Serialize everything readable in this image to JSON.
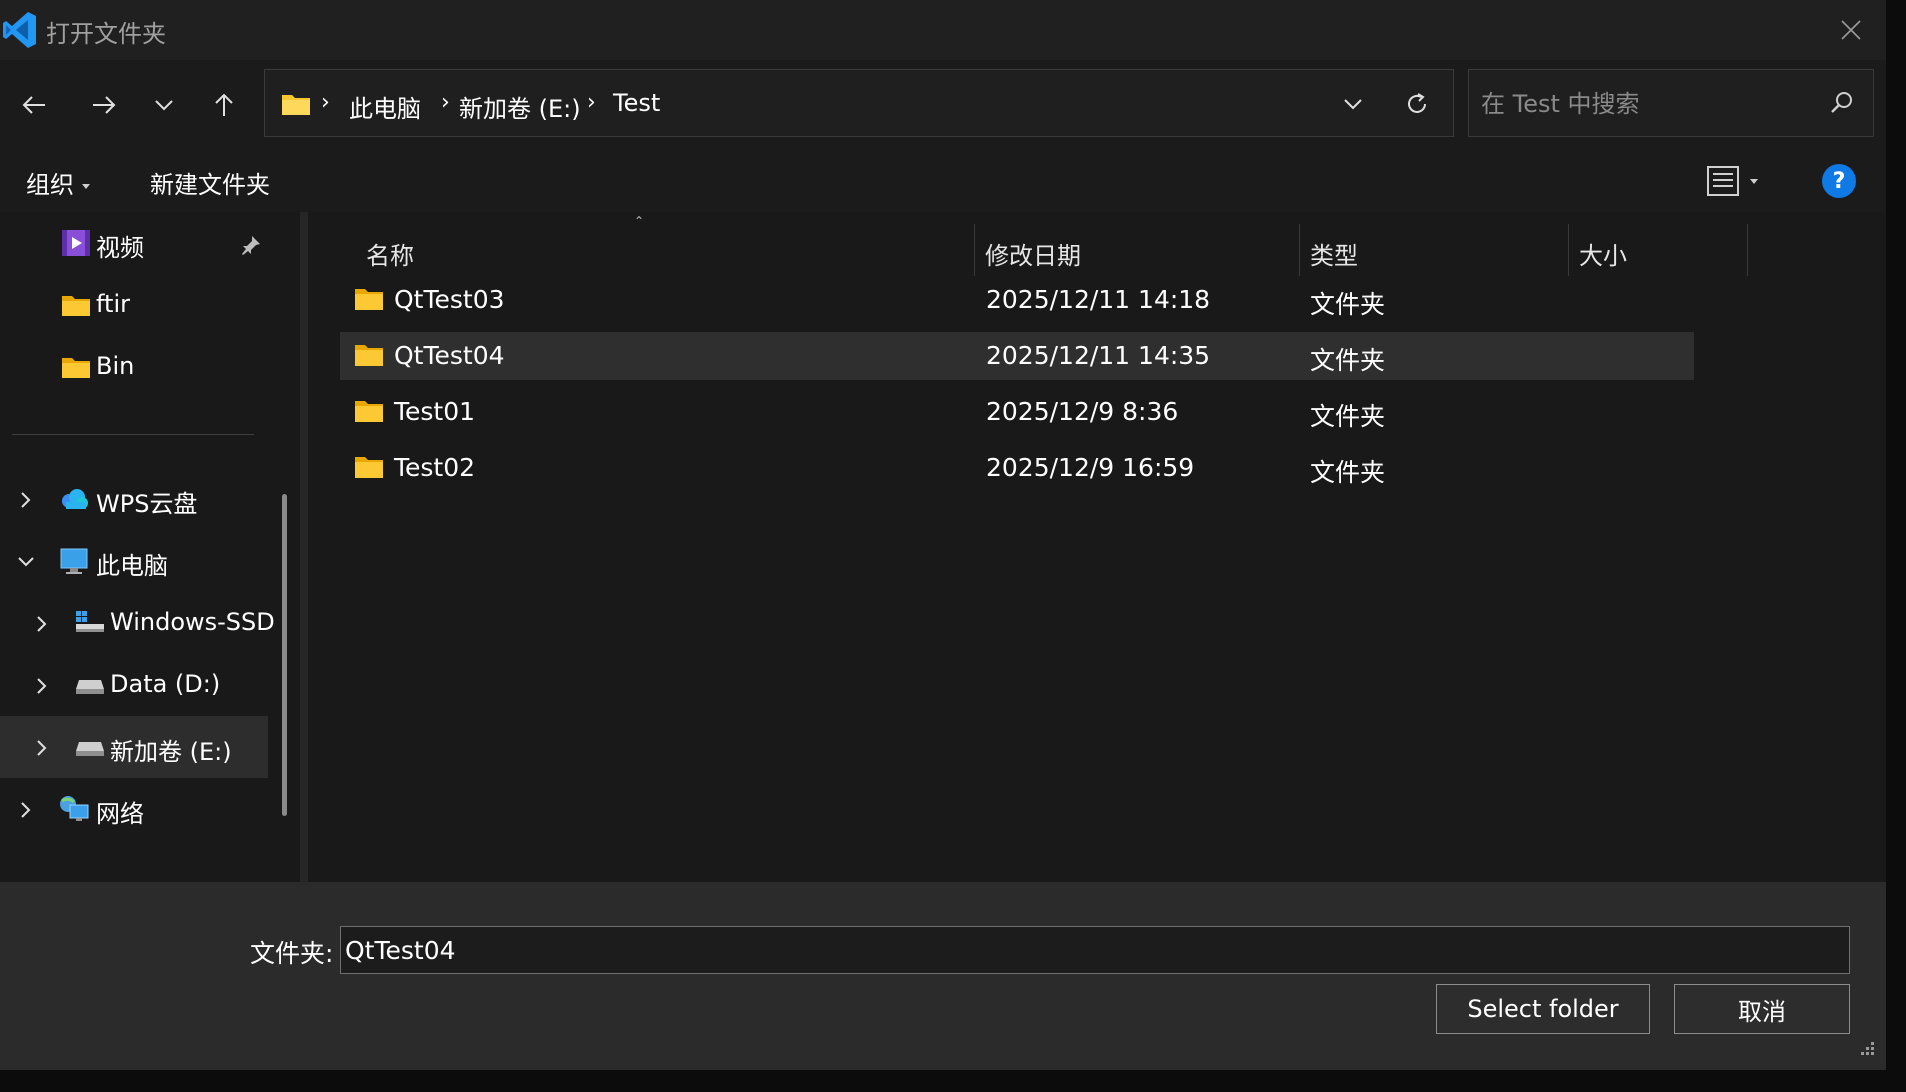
{
  "window": {
    "title": "打开文件夹",
    "app_icon": "vscode-logo-icon",
    "close_icon": "close-icon"
  },
  "navigation": {
    "back_icon": "arrow-left-icon",
    "forward_icon": "arrow-right-icon",
    "recent_icon": "chevron-down-icon",
    "up_icon": "arrow-up-icon"
  },
  "address_bar": {
    "folder_icon": "folder-icon",
    "breadcrumbs": [
      "此电脑",
      "新加卷 (E:)",
      "Test"
    ],
    "separator": "›",
    "dropdown_icon": "chevron-down-icon",
    "refresh_icon": "refresh-icon"
  },
  "search": {
    "placeholder": "在 Test 中搜索",
    "icon": "search-icon"
  },
  "command_bar": {
    "organize": "组织",
    "new_folder": "新建文件夹",
    "view_icon": "details-view-icon",
    "help_label": "?"
  },
  "sidebar": {
    "quick_access": [
      {
        "label": "视频",
        "icon": "video-icon",
        "pinned": true
      },
      {
        "label": "ftir",
        "icon": "folder-icon"
      },
      {
        "label": "Bin",
        "icon": "folder-icon"
      }
    ],
    "tree": [
      {
        "label": "WPS云盘",
        "icon": "cloud-icon",
        "expanded": false
      },
      {
        "label": "此电脑",
        "icon": "computer-icon",
        "expanded": true
      },
      {
        "label": "Windows-SSD",
        "icon": "windows-drive-icon",
        "expanded": false
      },
      {
        "label": "Data (D:)",
        "icon": "drive-icon",
        "expanded": false
      },
      {
        "label": "新加卷 (E:)",
        "icon": "drive-icon",
        "expanded": false,
        "selected": true
      },
      {
        "label": "网络",
        "icon": "network-icon",
        "expanded": false
      }
    ]
  },
  "file_list": {
    "columns": [
      "名称",
      "修改日期",
      "类型",
      "大小"
    ],
    "sort_column": "名称",
    "rows": [
      {
        "name": "QtTest03",
        "modified": "2025/12/11 14:18",
        "type": "文件夹",
        "size": "",
        "selected": false
      },
      {
        "name": "QtTest04",
        "modified": "2025/12/11 14:35",
        "type": "文件夹",
        "size": "",
        "selected": true
      },
      {
        "name": "Test01",
        "modified": "2025/12/9 8:36",
        "type": "文件夹",
        "size": "",
        "selected": false
      },
      {
        "name": "Test02",
        "modified": "2025/12/9 16:59",
        "type": "文件夹",
        "size": "",
        "selected": false
      }
    ]
  },
  "footer": {
    "field_label": "文件夹:",
    "field_value": "QtTest04",
    "select_button": "Select folder",
    "cancel_button": "取消"
  },
  "colors": {
    "background": "#202020",
    "pane": "#191919",
    "selection": "#2f2f2f",
    "folder_yellow": "#f8c630",
    "accent_blue": "#0f7ae5"
  }
}
